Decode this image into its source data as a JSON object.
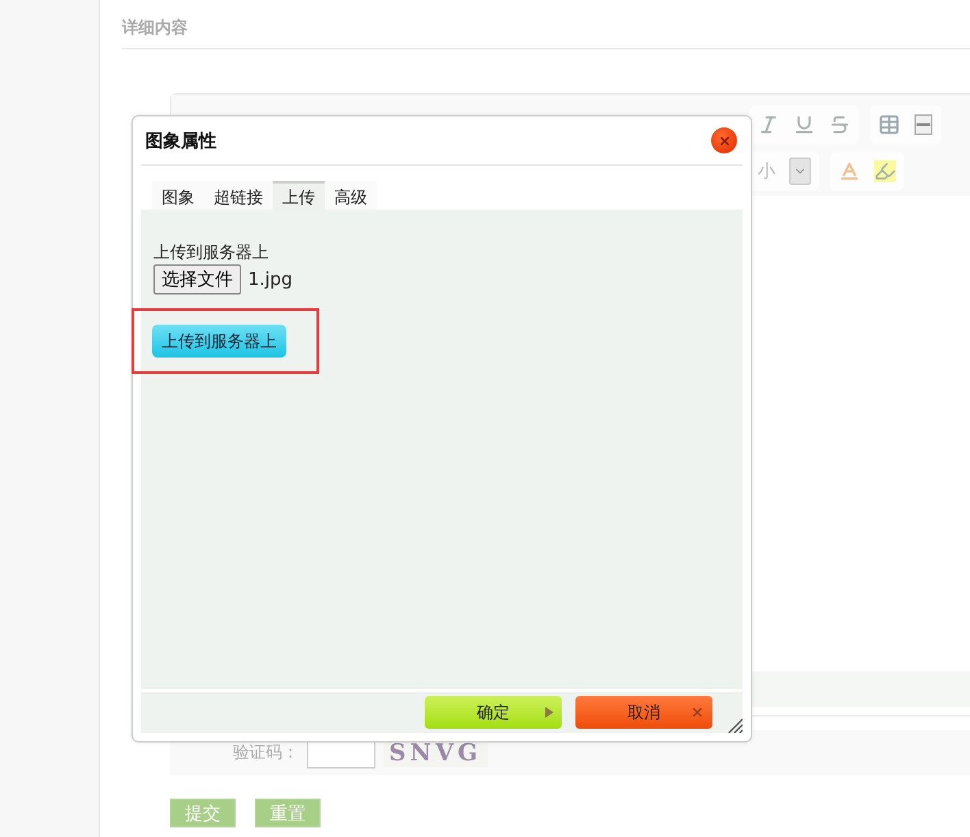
{
  "section_title": "详细内容",
  "editor": {
    "font_size_label": "小"
  },
  "dialog": {
    "title": "图象属性",
    "tabs": [
      {
        "label": "图象",
        "selected": false
      },
      {
        "label": "超链接",
        "selected": false
      },
      {
        "label": "上传",
        "selected": true
      },
      {
        "label": "高级",
        "selected": false
      }
    ],
    "upload_label": "上传到服务器上",
    "file_button": "选择文件",
    "file_name": "1.jpg",
    "upload_button": "上传到服务器上",
    "highlighted": true,
    "buttons": [
      {
        "label": "确定",
        "kind": "ok"
      },
      {
        "label": "取消",
        "kind": "cancel"
      }
    ]
  },
  "captcha": {
    "label": "验证码：",
    "image_text": "SNVG"
  },
  "buttons": [
    "提交",
    "重置"
  ]
}
